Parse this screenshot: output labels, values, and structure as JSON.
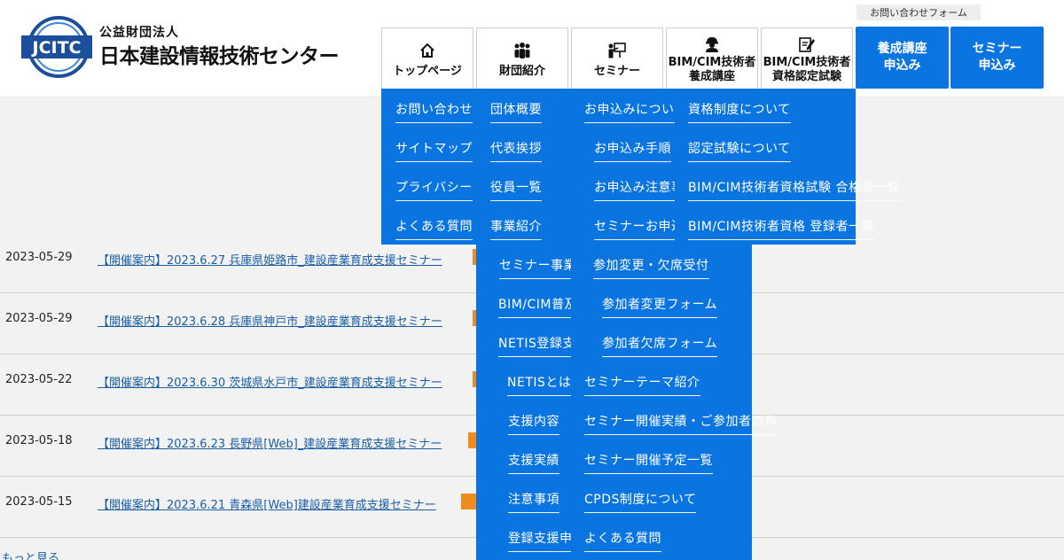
{
  "header": {
    "logo_text": "JCITC",
    "org_type": "公益財団法人",
    "org_name": "日本建設情報技術センター",
    "contact_link": "お問い合わせフォーム",
    "nav": [
      {
        "label": "トップページ",
        "icon": "home-icon"
      },
      {
        "label": "財団紹介",
        "icon": "people-icon"
      },
      {
        "label": "セミナー",
        "icon": "presentation-icon"
      },
      {
        "label": "BIM/CIM技術者\n養成講座",
        "icon": "worker-icon"
      },
      {
        "label": "BIM/CIM技術者\n資格認定試験",
        "icon": "edit-icon"
      }
    ],
    "apply": [
      {
        "label": "養成講座\n申込み"
      },
      {
        "label": "セミナー\n申込み"
      }
    ]
  },
  "menus": {
    "top": [
      "お問い合わせ",
      "サイトマップ",
      "プライバシー",
      "よくある質問"
    ],
    "foundation": [
      "団体概要",
      "代表挨拶",
      "役員一覧",
      "事業紹介"
    ],
    "foundation_sub": [
      "セミナー事業",
      "BIM/CIM普及",
      "NETIS登録支援",
      "NETISとは",
      "支援内容",
      "支援実績",
      "注意事項",
      "登録支援申込"
    ],
    "seminar_app": [
      "お申込みについて",
      "お申込み手順",
      "お申込み注意事項",
      "セミナーお申込み"
    ],
    "seminar": [
      "参加変更・欠席受付",
      "参加者変更フォーム",
      "参加者欠席フォーム",
      "セミナーテーマ紹介",
      "セミナー開催実績・ご参加者の声",
      "セミナー開催予定一覧",
      "CPDS制度について",
      "よくある質問"
    ],
    "exam": [
      "資格制度について",
      "認定試験について",
      "BIM/CIM技術者資格試験 合格者一覧",
      "BIM/CIM技術者資格 登録者一覧"
    ]
  },
  "news": [
    {
      "date": "2023-05-29",
      "title": "【開催案内】2023.6.27 兵庫県姫路市_建設産業育成支援セミナー"
    },
    {
      "date": "2023-05-29",
      "title": "【開催案内】2023.6.28 兵庫県神戸市_建設産業育成支援セミナー"
    },
    {
      "date": "2023-05-22",
      "title": "【開催案内】2023.6.30 茨城県水戸市_建設産業育成支援セミナー"
    },
    {
      "date": "2023-05-18",
      "title": "【開催案内】2023.6.23 長野県[Web]_建設産業育成支援セミナー"
    },
    {
      "date": "2023-05-15",
      "title": "【開催案内】2023.6.21 青森県[Web]建設産業育成支援セミナー"
    }
  ],
  "more_link": "もっと見る",
  "colors": {
    "accent": "#0a75e0",
    "tag": "#f08c1e",
    "link": "#1a5fa6"
  }
}
